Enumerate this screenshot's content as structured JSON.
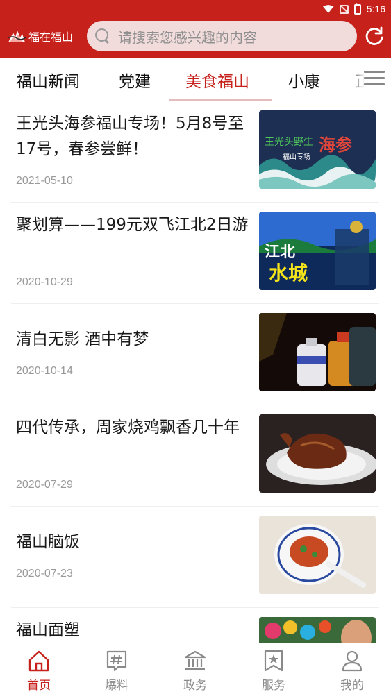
{
  "status_bar": {
    "time": "5:16"
  },
  "header": {
    "brand": "福在福山",
    "search_placeholder": "请搜索您感兴趣的内容",
    "brand_color": "#c7211c"
  },
  "tabs": [
    {
      "label": "福山新闻",
      "active": false
    },
    {
      "label": "党建",
      "active": false
    },
    {
      "label": "美食福山",
      "active": true
    },
    {
      "label": "小康",
      "active": false
    },
    {
      "label": "正",
      "active": false
    }
  ],
  "articles": [
    {
      "title": "王光头海参福山专场！5月8号至17号，春参尝鲜！",
      "date": "2021-05-10",
      "thumb_text_1": "王光头野生",
      "thumb_text_2": "海参",
      "thumb_text_3": "福山专场"
    },
    {
      "title": "聚划算——199元双飞江北2日游",
      "date": "2020-10-29",
      "thumb_text_1": "江北",
      "thumb_text_2": "水城"
    },
    {
      "title": "清白无影 酒中有梦",
      "date": "2020-10-14"
    },
    {
      "title": "四代传承，周家烧鸡飘香几十年",
      "date": "2020-07-29"
    },
    {
      "title": "福山脑饭",
      "date": "2020-07-23"
    },
    {
      "title": "福山面塑",
      "date": ""
    }
  ],
  "bottom_nav": [
    {
      "label": "首页",
      "icon": "home-icon",
      "active": true
    },
    {
      "label": "爆料",
      "icon": "hashtag-icon",
      "active": false
    },
    {
      "label": "政务",
      "icon": "government-building-icon",
      "active": false
    },
    {
      "label": "服务",
      "icon": "bookmark-star-icon",
      "active": false
    },
    {
      "label": "我的",
      "icon": "user-icon",
      "active": false
    }
  ]
}
